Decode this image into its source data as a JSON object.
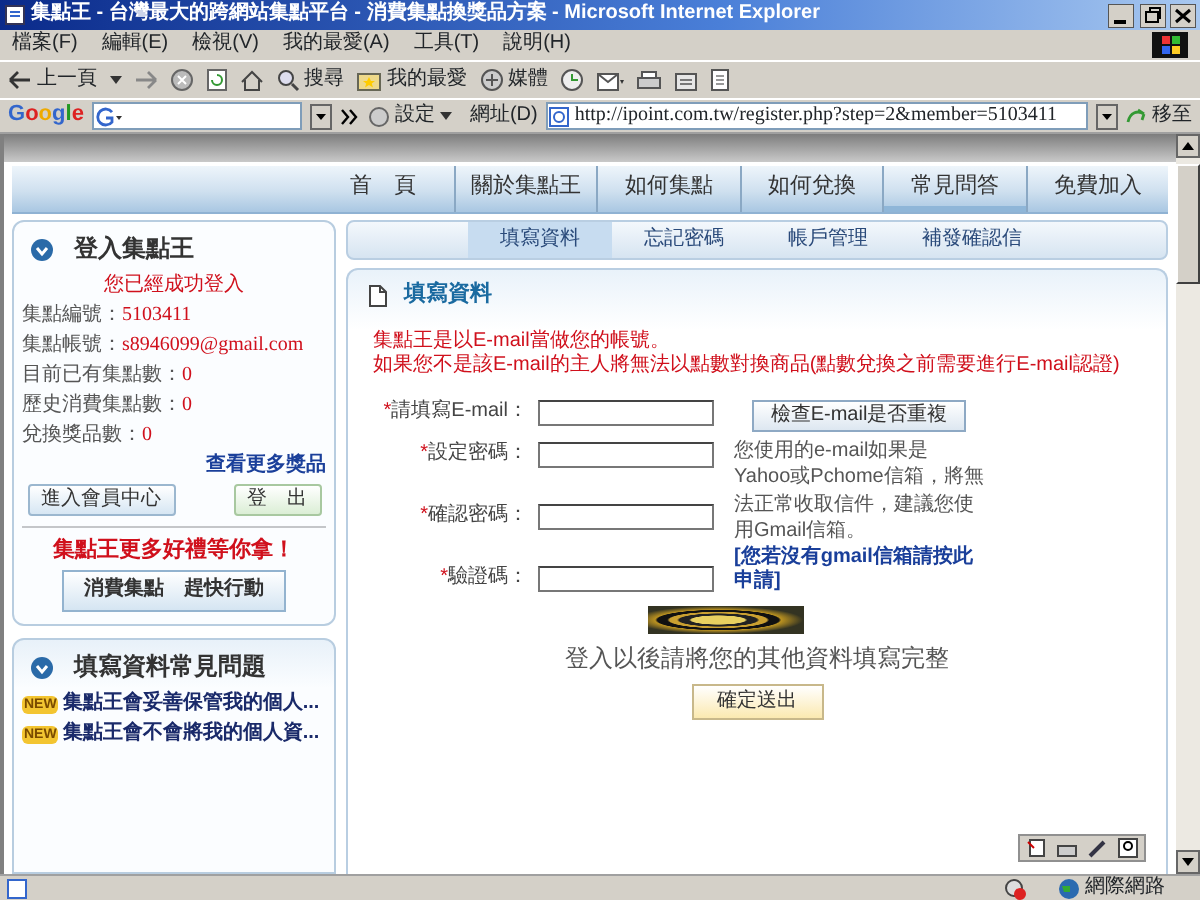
{
  "window": {
    "title": "集點王 - 台灣最大的跨網站集點平台 - 消費集點換獎品方案 - Microsoft Internet Explorer"
  },
  "menu_bar": [
    "檔案(F)",
    "編輯(E)",
    "檢視(V)",
    "我的最愛(A)",
    "工具(T)",
    "說明(H)"
  ],
  "toolbar": {
    "back_label": "上一頁",
    "search_label": "搜尋",
    "favorites_label": "我的最愛",
    "media_label": "媒體"
  },
  "address_bar": {
    "google_logo": "Google",
    "settings_label": "設定",
    "address_label": "網址(D)",
    "url": "http://ipoint.com.tw/register.php?step=2&member=5103411",
    "go_label": "移至"
  },
  "nav": {
    "items": [
      {
        "label": "首　頁",
        "selected": false
      },
      {
        "label": "關於集點王",
        "selected": false
      },
      {
        "label": "如何集點",
        "selected": false
      },
      {
        "label": "如何兌換",
        "selected": false
      },
      {
        "label": "常見問答",
        "selected": true
      },
      {
        "label": "免費加入",
        "selected": false
      }
    ]
  },
  "subnav": {
    "items": [
      {
        "label": "填寫資料",
        "selected": true
      },
      {
        "label": "忘記密碼",
        "selected": false
      },
      {
        "label": "帳戶管理",
        "selected": false
      },
      {
        "label": "補發確認信",
        "selected": false
      }
    ]
  },
  "login_box": {
    "title": "登入集點王",
    "status": "您已經成功登入",
    "fields": [
      {
        "label": "集點編號：",
        "value": "5103411"
      },
      {
        "label": "集點帳號：",
        "value": "s8946099@gmail.com"
      },
      {
        "label": "目前已有集點數：",
        "value": "0"
      },
      {
        "label": "歷史消費集點數：",
        "value": "0"
      },
      {
        "label": "兌換獎品數：",
        "value": "0"
      }
    ],
    "more_link": "查看更多獎品",
    "buttons": [
      {
        "label": "進入會員中心",
        "kind": "primary"
      },
      {
        "label": "登　出",
        "kind": "secondary"
      }
    ],
    "promo": "集點王更多好禮等你拿！",
    "action_button": "消費集點　趕快行動"
  },
  "faq_box": {
    "title": "填寫資料常見問題",
    "items": [
      {
        "badge": "NEW",
        "text": "集點王會妥善保管我的個人..."
      },
      {
        "badge": "NEW",
        "text": "集點王會不會將我的個人資..."
      }
    ]
  },
  "form": {
    "title": "填寫資料",
    "notice": [
      "集點王是以E-mail當做您的帳號。",
      "如果您不是該E-mail的主人將無法以點數對換商品(點數兌換之前需要進行E-mail認證)"
    ],
    "fields": [
      {
        "marker": "*",
        "label": "請填寫E-mail："
      },
      {
        "marker": "*",
        "label": "設定密碼："
      },
      {
        "marker": "*",
        "label": "確認密碼："
      },
      {
        "marker": "*",
        "label": "驗證碼："
      }
    ],
    "check_button": "檢查E-mail是否重複",
    "hint": "您使用的e-mail如果是Yahoo或Pchome信箱，將無法正常收取信件，建議您使用Gmail信箱。",
    "apply_link": "[您若沒有gmail信箱請按此申請]",
    "note": "登入以後請將您的其他資料填寫完整",
    "submit": "確定送出"
  },
  "status_bar": {
    "zone": "網際網路"
  }
}
